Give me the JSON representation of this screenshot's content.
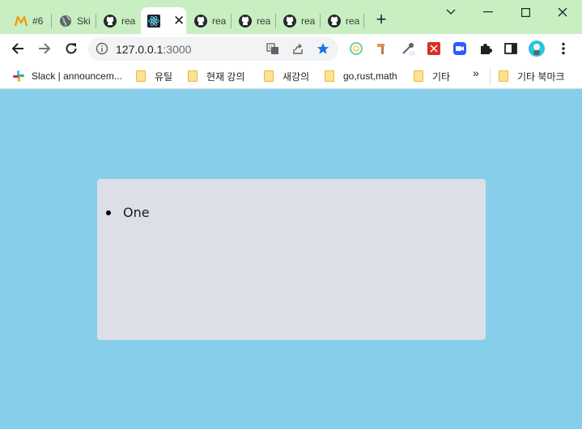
{
  "tabs": [
    {
      "title": "#6",
      "icon": "m-logo-icon"
    },
    {
      "title": "Ski",
      "icon": "globe-icon"
    },
    {
      "title": "rea",
      "icon": "github-icon"
    },
    {
      "title": "",
      "icon": "react-icon",
      "active": true
    },
    {
      "title": "rea",
      "icon": "github-icon"
    },
    {
      "title": "rea",
      "icon": "github-icon"
    },
    {
      "title": "rea",
      "icon": "github-icon"
    },
    {
      "title": "rea",
      "icon": "github-icon"
    }
  ],
  "tab_close_glyph": "✕",
  "new_tab_glyph": "+",
  "address": {
    "host": "127.0.0.1",
    "port": ":3000"
  },
  "bookmarks": [
    {
      "label": "Slack | announcem...",
      "icon": "slack-icon"
    },
    {
      "label": "유틸",
      "icon": "folder-icon"
    },
    {
      "label": "현재 강의",
      "icon": "folder-icon"
    },
    {
      "label": "새강의",
      "icon": "folder-icon"
    },
    {
      "label": "go,rust,math",
      "icon": "folder-icon"
    },
    {
      "label": "기타",
      "icon": "folder-icon"
    },
    {
      "label": "기타 북마크",
      "icon": "folder-icon"
    }
  ],
  "bookmarks_overflow": "»",
  "list": {
    "items": [
      "One"
    ]
  },
  "colors": {
    "tabstrip": "#c9eec2",
    "page_bg": "#87ceeb",
    "card_bg": "#dcdfe8",
    "star": "#1a73e8"
  }
}
